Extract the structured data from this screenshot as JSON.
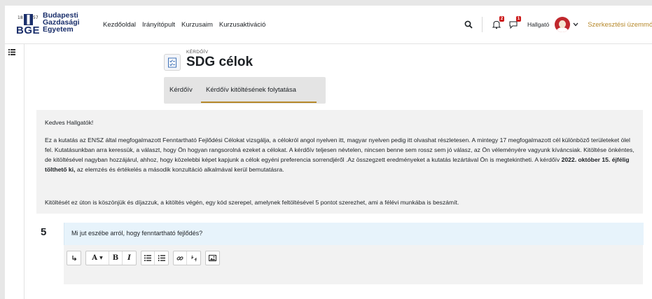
{
  "university": {
    "abbr": "BGE",
    "name_line1": "Budapesti",
    "name_line2": "Gazdasági",
    "name_line3": "Egyetem",
    "year_left": "18",
    "year_right": "57"
  },
  "nav": {
    "items": [
      "Kezdőoldal",
      "Irányítópult",
      "Kurzusaim",
      "Kurzusaktiváció"
    ]
  },
  "user": {
    "role": "Hallgató",
    "notification_count": "2",
    "message_count": "1"
  },
  "edit_mode_label": "Szerkesztési üzemmód",
  "colors": {
    "accent": "#b6882a",
    "badge": "#cc1b1b",
    "brand": "#1a2f6b",
    "question_bg": "#e7f3fb"
  },
  "activity": {
    "type_label": "KÉRDŐÍV",
    "title": "SDG célok"
  },
  "tabs": [
    {
      "label": "Kérdőív",
      "active": false
    },
    {
      "label": "Kérdőív kitöltésének folytatása",
      "active": true
    }
  ],
  "intro": {
    "greeting": "Kedves Hallgatók!",
    "body_part1": "Ez a kutatás az ENSZ által megfogalmazott Fenntartható Fejlődési Célokat vizsgálja, a célokról angol nyelven itt, magyar nyelven pedig itt olvashat részletesen. A mintegy 17 megfogalmazott cél különböző területeket ölel fel. Kutatásunkban arra keressük, a választ, hogy Ön hogyan rangsorolná ezeket a célokat. A kérdőív teljesen névtelen, nincsen benne sem rossz sem jó válasz, az Ön véleményére vagyunk kíváncsiak. Kitöltése önkéntes, de kitöltésével nagyban hozzájárul, ahhoz, hogy közelebbi képet kapjunk a célok egyéni preferencia sorrendjéről .Az összegzett eredményeket a kutatás lezártával Ön is megtekintheti. A kérdőív ",
    "body_bold": "2022. október 15. éjfélig tölthető ki,",
    "body_part2": " az elemzés és értékelés a második konzultáció alkalmával kerül bemutatásra.",
    "thanks": "Kitöltését ez úton is köszönjük és díjazzuk, a kitöltés végén, egy kód szerepel, amelynek feltöltésével 5 pontot szerezhet, ami a félévi munkába is beszámít."
  },
  "question": {
    "number": "5",
    "text": "Mi jut eszébe arról, hogy fenntartható fejlődés?"
  },
  "toolbar": {
    "font_label": "A",
    "bold_label": "B",
    "italic_label": "I"
  },
  "icons": [
    "search-icon",
    "bell-icon",
    "chat-icon",
    "chevron-down-icon",
    "drawer-toggle-icon",
    "questionnaire-icon",
    "collapse-toolbar-icon",
    "bullet-list-icon",
    "numbered-list-icon",
    "link-icon",
    "unlink-icon",
    "image-icon"
  ]
}
